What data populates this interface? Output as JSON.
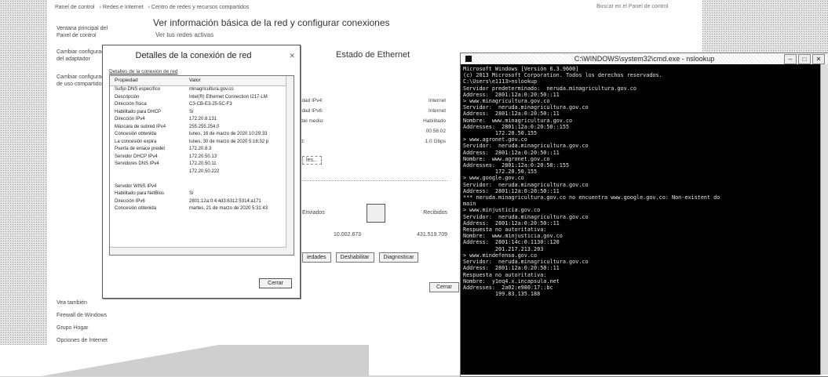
{
  "background_window": {
    "breadcrumb": [
      "Panel de control",
      "Redes e Internet",
      "Centro de redes y recursos compartidos"
    ],
    "search_placeholder": "Buscar en el Panel de control",
    "title": "Ver información básica de la red y configurar conexiones",
    "subtitle": "Ver tus redes activas",
    "sidebar": [
      "Ventana principal del Panel de control",
      "Cambiar configuración del adaptador",
      "Cambiar configuración de uso compartido"
    ],
    "sidebar_bottom": [
      "Vea también",
      "Firewall de Windows",
      "Grupo Hogar",
      "Opciones de Internet"
    ]
  },
  "ethernet_status": {
    "title": "Estado de Ethernet",
    "rows": [
      {
        "label": "idad IPv4:",
        "value": "Internet"
      },
      {
        "label": "idad IPv6:",
        "value": "Internet"
      },
      {
        "label": "del medio:",
        "value": "Habilitado"
      },
      {
        "label": "",
        "value": "00:56:02"
      },
      {
        "label": "d:",
        "value": "1.0 Gbps"
      }
    ],
    "details_button": "les...",
    "sent_label": "Enviados",
    "received_label": "Recibidos",
    "bytes_sent": "10.002.873",
    "bytes_received": "431.519.709",
    "buttons": [
      "iedades",
      "Deshabilitar",
      "Diagnosticar"
    ],
    "close_button": "Cerrar"
  },
  "details_dialog": {
    "title": "Detalles de la conexión de red",
    "label": "Detalles de la conexión de red",
    "col_property": "Propiedad",
    "col_value": "Valor",
    "rows": [
      {
        "p": "Sufijo DNS específico",
        "v": "minagricultura.gov.co"
      },
      {
        "p": "Descripción",
        "v": "Intel(R) Ethernet Connection I217-LM"
      },
      {
        "p": "Dirección física",
        "v": "C3-CB-E3-25-5C-F3"
      },
      {
        "p": "Habilitado para DHCP",
        "v": "Sí"
      },
      {
        "p": "Dirección IPv4",
        "v": "172.20.8.131"
      },
      {
        "p": "Máscara de subred IPv4",
        "v": "255.255.254.0"
      },
      {
        "p": "Concesión obtenida",
        "v": "lunes, 16 de marzo de 2020 10:29:33"
      },
      {
        "p": "La concesión expira",
        "v": "lunes, 30 de marzo de 2020 5:16:32 p"
      },
      {
        "p": "Puerta de enlace predet",
        "v": "172.20.8.3"
      },
      {
        "p": "Servidor DHCP IPv4",
        "v": "172.20.50.13"
      },
      {
        "p": "Servidores DNS IPv4",
        "v": "172.20.50.11"
      },
      {
        "p": "",
        "v": "172.20.50.222"
      },
      {
        "p": "",
        "v": ""
      },
      {
        "p": "Servidor WINS IPv4",
        "v": ""
      },
      {
        "p": "Habilitado para NetBios",
        "v": "Sí"
      },
      {
        "p": "Dirección IPv6",
        "v": "2801:12a:0:4:4d3:6312:5314:a171"
      },
      {
        "p": "Concesión obtenida",
        "v": "martes, 21 de marzo de 2020 5:31:43"
      }
    ],
    "close_button": "Cerrar"
  },
  "cmd": {
    "title": "C:\\WINDOWS\\system32\\cmd.exe - nslookup",
    "lines": [
      "Microsoft Windows [Versión 6.3.9600]",
      "(c) 2013 Microsoft Corporation. Todos los derechos reservados.",
      "",
      "C:\\Users\\e1113>nslookup",
      "Servidor predeterminado:  neruda.minagricultura.gov.co",
      "Address:  2801:12a:0:20:50::11",
      "",
      "> www.minagricultura.gov.co",
      "Servidor:  neruda.minagricultura.gov.co",
      "Address:  2801:12a:0:20:50::11",
      "",
      "Nombre:  www.minagricultura.gov.co",
      "Addresses:  2801:12a:0:20:50::155",
      "          172.20.50.155",
      "",
      "> www.agronet.gov.co",
      "Servidor:  neruda.minagricultura.gov.co",
      "Address:  2801:12a:0:20:50::11",
      "",
      "Nombre:  www.agronet.gov.co",
      "Addresses:  2801:12a:0:20:50::155",
      "          172.20.50.155",
      "",
      "> www.google.gov.co",
      "Servidor:  neruda.minagricultura.gov.co",
      "Address:  2801:12a:0:20:50::11",
      "",
      "*** neruda.minagricultura.gov.co no encuentra www.google.gov.co: Non-existent do",
      "main",
      "> www.minjusticia.gov.co",
      "Servidor:  neruda.minagricultura.gov.co",
      "Address:  2801:12a:0:20:50::11",
      "",
      "Respuesta no autoritativa:",
      "Nombre:  www.minjusticia.gov.co",
      "Address:  2801:14c:0:1130::120",
      "          201.217.213.203",
      "",
      "> www.mindefensa.gov.co",
      "Servidor:  neruda.minagricultura.gov.co",
      "Address:  2801:12a:0:20:50::11",
      "",
      "Respuesta no autoritativa:",
      "Nombre:  y1eq4.x.incapsula.net",
      "Addresses:  2a02:e980:17::bc",
      "          199.83.135.188"
    ]
  }
}
